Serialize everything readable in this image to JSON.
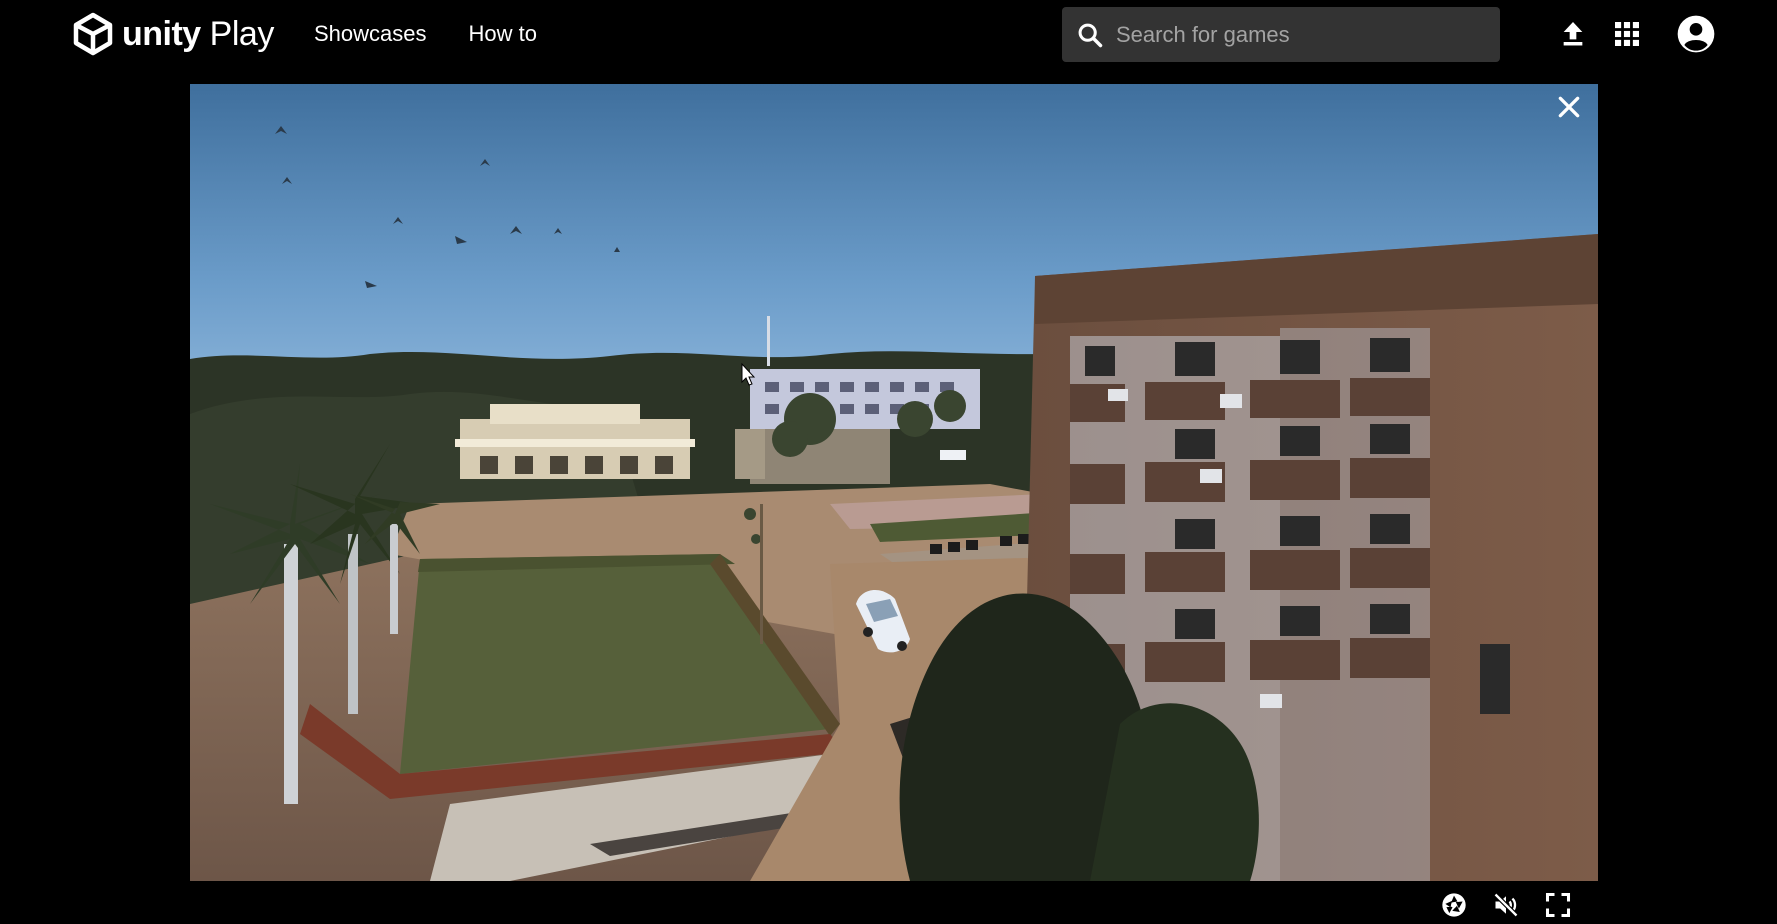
{
  "header": {
    "logo": {
      "text_bold": "unity",
      "text_light": "Play"
    },
    "nav": [
      {
        "label": "Showcases"
      },
      {
        "label": "How to"
      }
    ],
    "search": {
      "placeholder": "Search for games",
      "value": ""
    },
    "icons": {
      "search": "search-icon",
      "upload": "upload-icon",
      "apps": "apps-grid-icon",
      "account": "account-icon"
    }
  },
  "game": {
    "icons": {
      "close": "close-icon"
    }
  },
  "player_controls": {
    "icons": [
      "screenshot-icon",
      "mute-icon",
      "fullscreen-icon"
    ]
  },
  "colors": {
    "background": "#000000",
    "search_bg": "#333333",
    "search_placeholder": "#a3a3a3",
    "sky": "#5f8fbd",
    "text": "#ffffff"
  }
}
